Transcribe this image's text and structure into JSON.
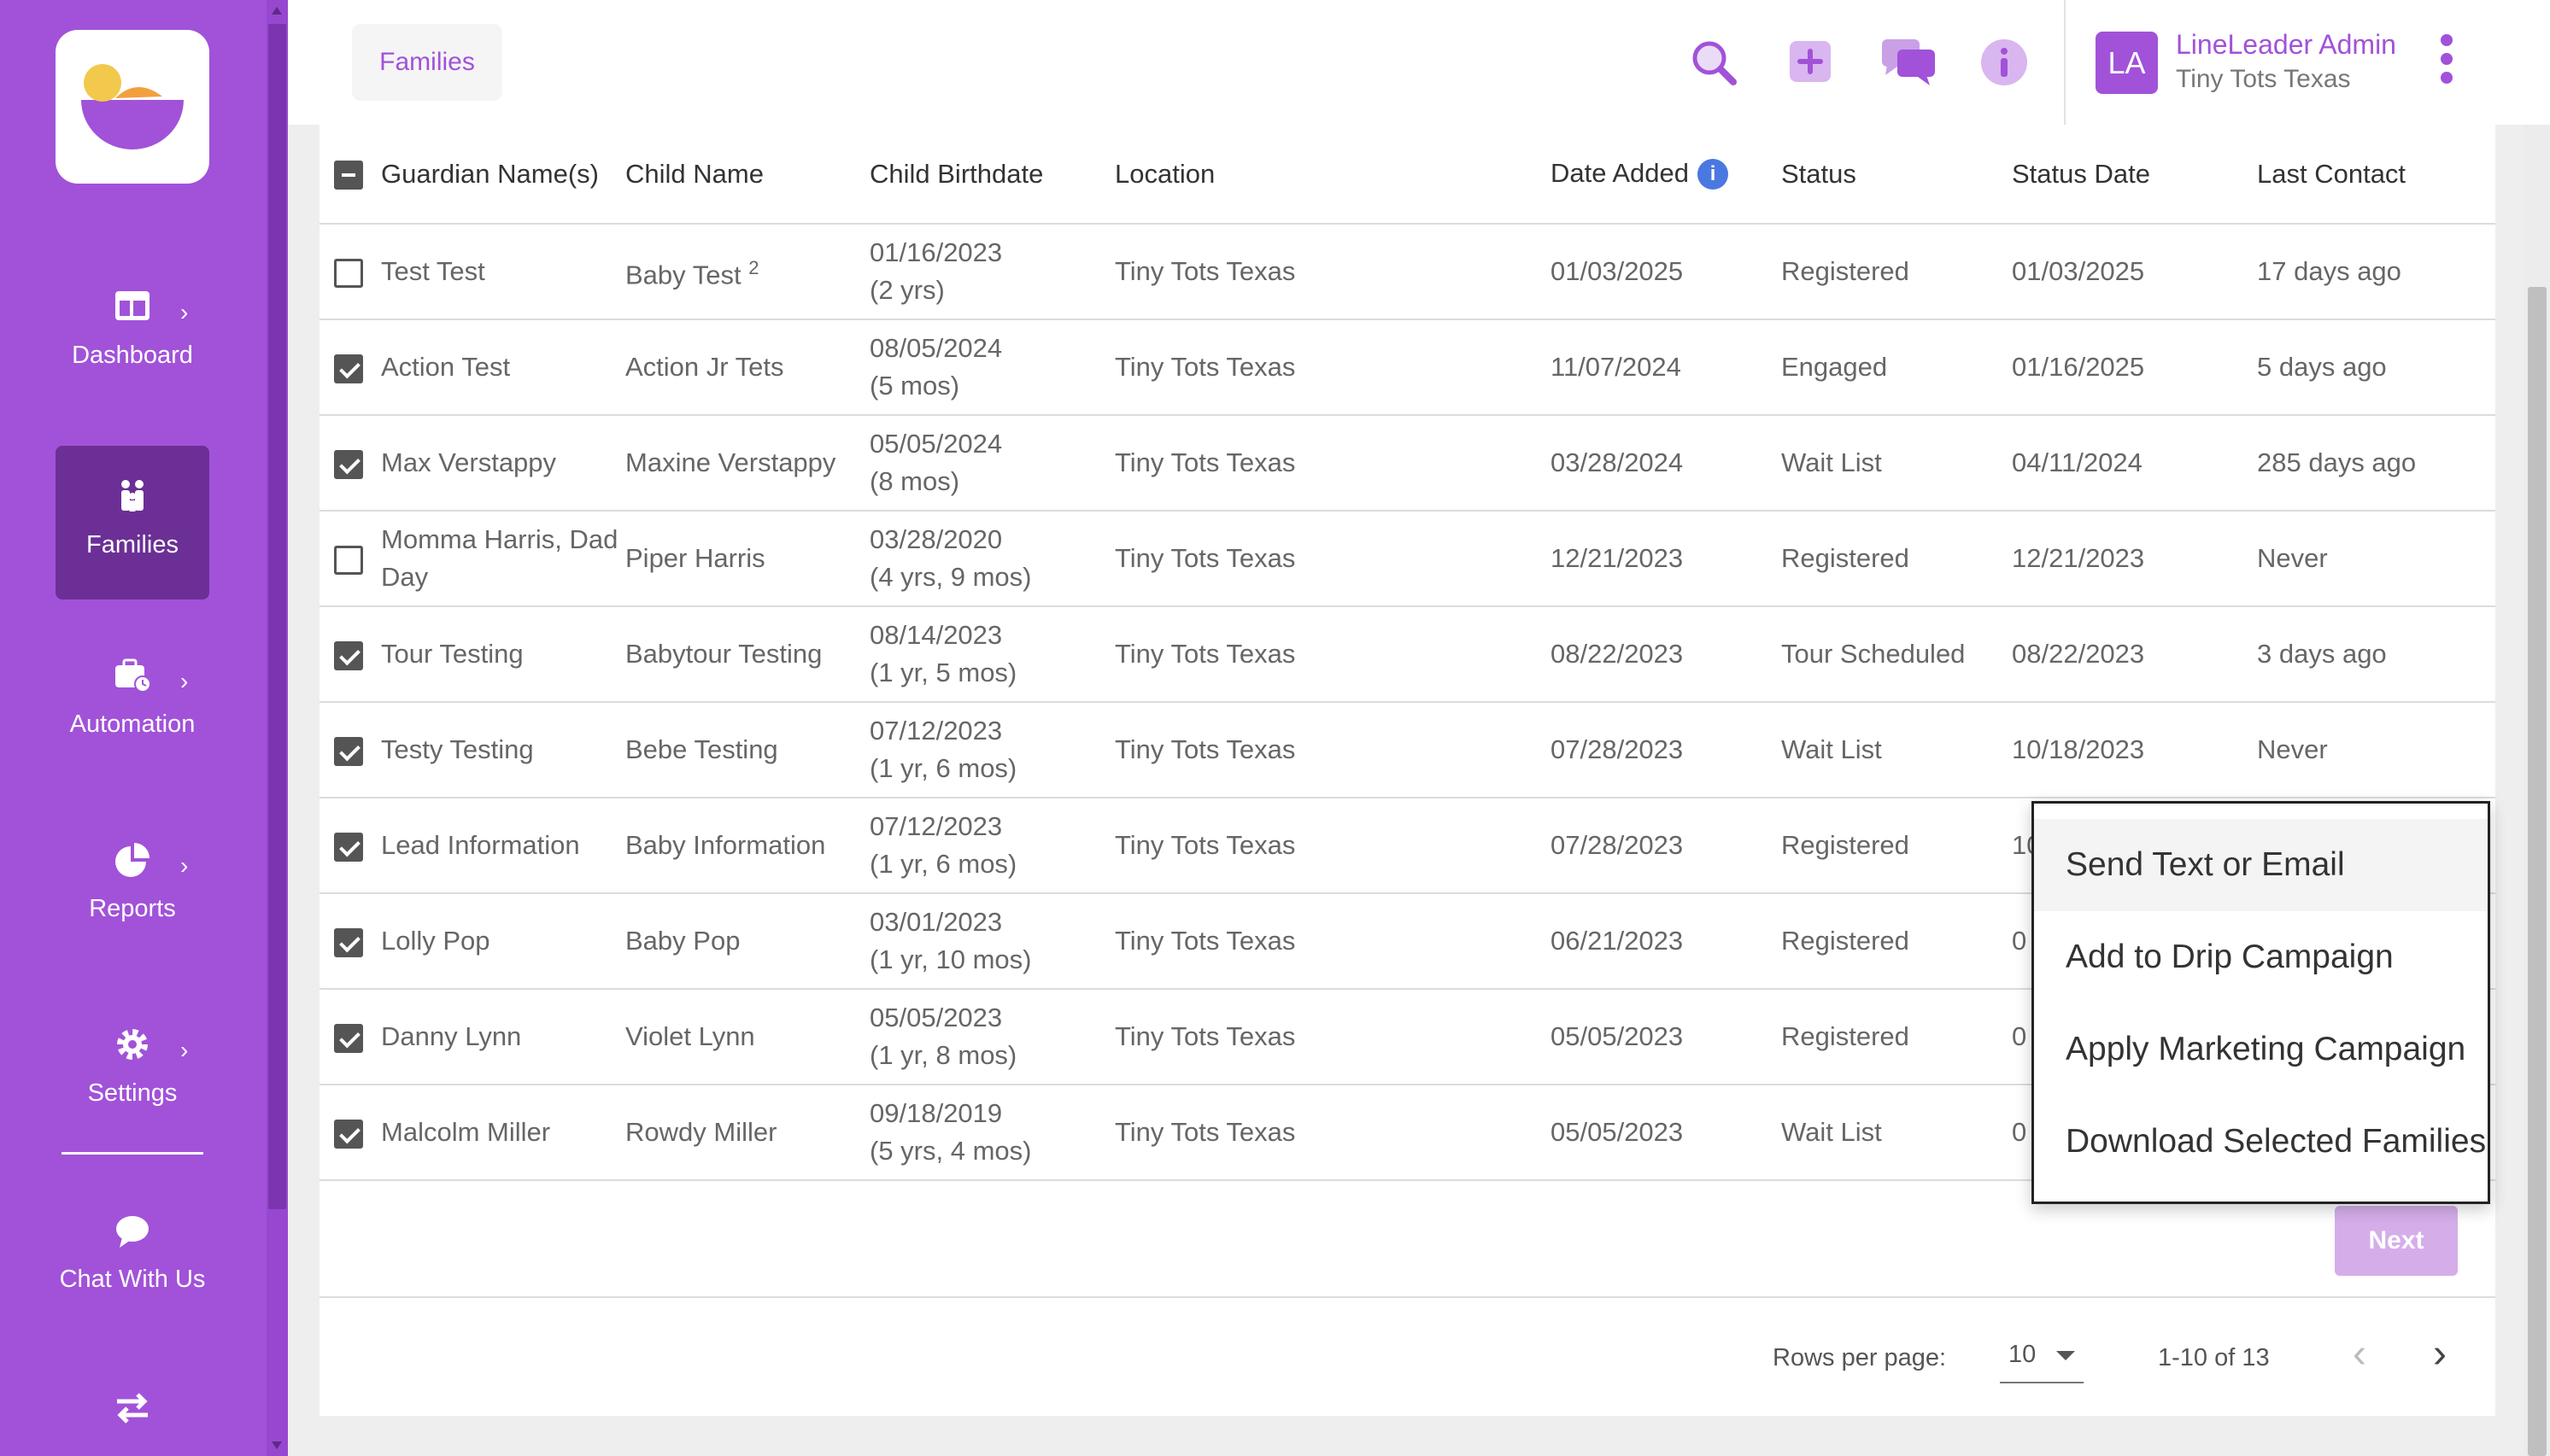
{
  "sidebar": {
    "items": [
      {
        "label": "Dashboard"
      },
      {
        "label": "Families"
      },
      {
        "label": "Automation"
      },
      {
        "label": "Reports"
      },
      {
        "label": "Settings"
      },
      {
        "label": "Chat With Us"
      }
    ]
  },
  "header": {
    "breadcrumb": "Families",
    "icons": [
      "search-icon",
      "add-icon",
      "chat-icon",
      "info-icon",
      "more-vertical-icon"
    ],
    "user": {
      "initials": "LA",
      "name": "LineLeader Admin",
      "org": "Tiny Tots Texas"
    }
  },
  "table": {
    "columns": [
      "Guardian Name(s)",
      "Child Name",
      "Child Birthdate",
      "Location",
      "Date Added",
      "Status",
      "Status Date",
      "Last Contact"
    ],
    "rows": [
      {
        "checked": false,
        "guardian": "Test Test",
        "child": "Baby Test",
        "child_sup": "2",
        "birthdate": "01/16/2023",
        "age": "(2 yrs)",
        "location": "Tiny Tots Texas",
        "date_added": "01/03/2025",
        "status": "Registered",
        "status_date": "01/03/2025",
        "last_contact": "17 days ago"
      },
      {
        "checked": true,
        "guardian": "Action Test",
        "child": "Action Jr Tets",
        "birthdate": "08/05/2024",
        "age": "(5 mos)",
        "location": "Tiny Tots Texas",
        "date_added": "11/07/2024",
        "status": "Engaged",
        "status_date": "01/16/2025",
        "last_contact": "5 days ago"
      },
      {
        "checked": true,
        "guardian": "Max Verstappy",
        "child": "Maxine Verstappy",
        "birthdate": "05/05/2024",
        "age": "(8 mos)",
        "location": "Tiny Tots Texas",
        "date_added": "03/28/2024",
        "status": "Wait List",
        "status_date": "04/11/2024",
        "last_contact": "285 days ago"
      },
      {
        "checked": false,
        "guardian": "Momma Harris, Dad Day",
        "child": "Piper Harris",
        "birthdate": "03/28/2020",
        "age": "(4 yrs, 9 mos)",
        "location": "Tiny Tots Texas",
        "date_added": "12/21/2023",
        "status": "Registered",
        "status_date": "12/21/2023",
        "last_contact": "Never"
      },
      {
        "checked": true,
        "guardian": "Tour Testing",
        "child": "Babytour Testing",
        "birthdate": "08/14/2023",
        "age": "(1 yr, 5 mos)",
        "location": "Tiny Tots Texas",
        "date_added": "08/22/2023",
        "status": "Tour Scheduled",
        "status_date": "08/22/2023",
        "last_contact": "3 days ago"
      },
      {
        "checked": true,
        "guardian": "Testy Testing",
        "child": "Bebe Testing",
        "birthdate": "07/12/2023",
        "age": "(1 yr, 6 mos)",
        "location": "Tiny Tots Texas",
        "date_added": "07/28/2023",
        "status": "Wait List",
        "status_date": "10/18/2023",
        "last_contact": "Never"
      },
      {
        "checked": true,
        "guardian": "Lead Information",
        "child": "Baby Information",
        "birthdate": "07/12/2023",
        "age": "(1 yr, 6 mos)",
        "location": "Tiny Tots Texas",
        "date_added": "07/28/2023",
        "status": "Registered",
        "status_date": "10",
        "last_contact": ""
      },
      {
        "checked": true,
        "guardian": "Lolly Pop",
        "child": "Baby Pop",
        "birthdate": "03/01/2023",
        "age": "(1 yr, 10 mos)",
        "location": "Tiny Tots Texas",
        "date_added": "06/21/2023",
        "status": "Registered",
        "status_date": "0",
        "last_contact": ""
      },
      {
        "checked": true,
        "guardian": "Danny Lynn",
        "child": "Violet Lynn",
        "birthdate": "05/05/2023",
        "age": "(1 yr, 8 mos)",
        "location": "Tiny Tots Texas",
        "date_added": "05/05/2023",
        "status": "Registered",
        "status_date": "0",
        "last_contact": ""
      },
      {
        "checked": true,
        "guardian": "Malcolm Miller",
        "child": "Rowdy Miller",
        "birthdate": "09/18/2019",
        "age": "(5 yrs, 4 mos)",
        "location": "Tiny Tots Texas",
        "date_added": "05/05/2023",
        "status": "Wait List",
        "status_date": "0",
        "last_contact": ""
      }
    ]
  },
  "actions": {
    "next_label": "Next",
    "menu": [
      "Send Text or Email",
      "Add to Drip Campaign",
      "Apply Marketing Campaign",
      "Download Selected Families"
    ]
  },
  "pagination": {
    "rows_per_page_label": "Rows per page:",
    "rows_per_page": "10",
    "range": "1-10 of 13"
  },
  "colors": {
    "accent": "#a152d9",
    "sidebar_active": "#6b2f96",
    "info_blue": "#4a78e0"
  }
}
